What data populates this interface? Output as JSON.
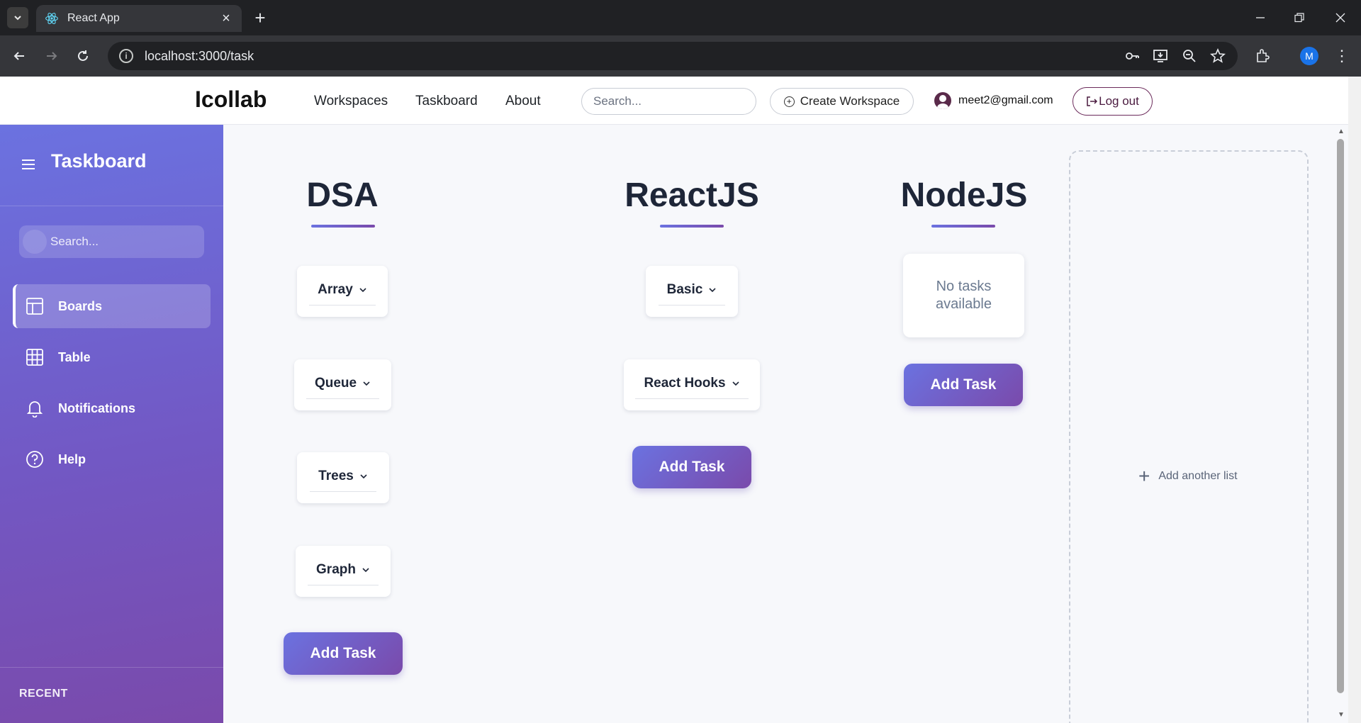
{
  "browser": {
    "tab_title": "React App",
    "url": "localhost:3000/task",
    "profile_initial": "M"
  },
  "header": {
    "brand": "Icollab",
    "nav": [
      "Workspaces",
      "Taskboard",
      "About"
    ],
    "search_placeholder": "Search...",
    "create_workspace": "Create Workspace",
    "user_email": "meet2@gmail.com",
    "logout": "Log out"
  },
  "sidebar": {
    "title": "Taskboard",
    "search_placeholder": "Search...",
    "items": [
      {
        "label": "Boards",
        "icon": "layout-icon",
        "active": true
      },
      {
        "label": "Table",
        "icon": "table-icon",
        "active": false
      },
      {
        "label": "Notifications",
        "icon": "bell-icon",
        "active": false
      },
      {
        "label": "Help",
        "icon": "help-icon",
        "active": false
      }
    ],
    "recent_label": "RECENT"
  },
  "board": {
    "columns": [
      {
        "title": "DSA",
        "tasks": [
          "Array",
          "Queue",
          "Trees",
          "Graph"
        ],
        "add_label": "Add Task"
      },
      {
        "title": "ReactJS",
        "tasks": [
          "Basic",
          "React Hooks"
        ],
        "add_label": "Add Task"
      },
      {
        "title": "NodeJS",
        "tasks": [],
        "empty_text": "No tasks available",
        "add_label": "Add Task"
      }
    ],
    "add_list_label": "Add another list"
  },
  "colors": {
    "accent_start": "#6b72e0",
    "accent_end": "#7a4aab",
    "title_text": "#1e2638"
  }
}
